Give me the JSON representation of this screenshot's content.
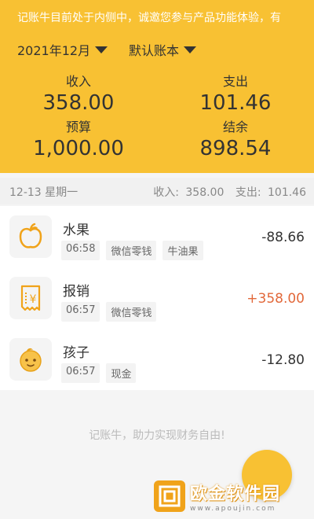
{
  "header": {
    "notice": "记账牛目前处于内侧中，诚邀您参与产品功能体验，有",
    "month_label": "2021年12月",
    "book_label": "默认账本",
    "stats": {
      "income_label": "收入",
      "income_value": "358.00",
      "expense_label": "支出",
      "expense_value": "101.46",
      "budget_label": "预算",
      "budget_value": "1,000.00",
      "balance_label": "结余",
      "balance_value": "898.54"
    },
    "colors": {
      "accent": "#f8c133"
    }
  },
  "day": {
    "date": "12-13 星期一",
    "income_label": "收入:",
    "income_value": "358.00",
    "expense_label": "支出:",
    "expense_value": "101.46"
  },
  "items": [
    {
      "name": "水果",
      "time": "06:58",
      "account": "微信零钱",
      "note": "牛油果",
      "amount": "-88.66",
      "icon": "apple-icon"
    },
    {
      "name": "报销",
      "time": "06:57",
      "account": "微信零钱",
      "amount": "+358.00",
      "icon": "receipt-icon"
    },
    {
      "name": "孩子",
      "time": "06:57",
      "account": "现金",
      "amount": "-12.80",
      "icon": "child-face-icon"
    }
  ],
  "footer": {
    "slogan": "记账牛，助力实现财务自由!"
  },
  "watermark": {
    "text": "欧金软件园",
    "url": "www.apoujin.com"
  }
}
